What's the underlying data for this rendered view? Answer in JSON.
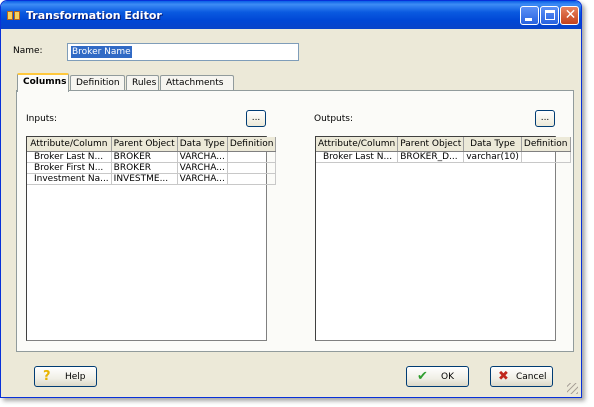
{
  "window": {
    "title": "Transformation Editor"
  },
  "form": {
    "name_label": "Name:",
    "name_value": "Broker Name"
  },
  "tabs": [
    {
      "label": "Columns"
    },
    {
      "label": "Definition"
    },
    {
      "label": "Rules"
    },
    {
      "label": "Attachments"
    }
  ],
  "inputs": {
    "label": "Inputs:",
    "browse_label": "...",
    "headers": [
      "Attribute/Column",
      "Parent Object",
      "Data Type",
      "Definition"
    ],
    "rows": [
      [
        "Broker Last N...",
        "BROKER",
        "VARCHA...",
        ""
      ],
      [
        "Broker First N...",
        "BROKER",
        "VARCHA...",
        ""
      ],
      [
        "Investment Na...",
        "INVESTME...",
        "VARCHA...",
        ""
      ]
    ]
  },
  "outputs": {
    "label": "Outputs:",
    "browse_label": "...",
    "headers": [
      "Attribute/Column",
      "Parent Object",
      "Data Type",
      "Definition"
    ],
    "rows": [
      [
        "Broker Last N...",
        "BROKER_D...",
        "varchar(10)",
        ""
      ]
    ]
  },
  "buttons": {
    "help": "Help",
    "ok": "OK",
    "cancel": "Cancel"
  },
  "icons": {
    "app": "app-icon",
    "help": "question-icon",
    "ok": "check-icon",
    "cancel": "x-icon",
    "minimize": "minimize-icon",
    "maximize": "maximize-icon",
    "close": "close-icon"
  },
  "colors": {
    "titlebar": "#0a5ae0",
    "selection": "#316ac5",
    "ok_icon": "#2f9e2f",
    "cancel_icon": "#c0281c",
    "help_icon": "#e8b400"
  }
}
